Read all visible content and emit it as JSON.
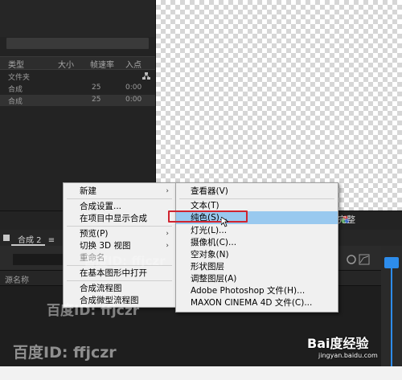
{
  "project_panel": {
    "columns": [
      "类型",
      "大小",
      "帧速率",
      "入点"
    ],
    "rows": [
      {
        "type": "文件夹",
        "size": "",
        "fps": "",
        "in": ""
      },
      {
        "type": "合成",
        "size": "",
        "fps": "25",
        "in": "0:00"
      },
      {
        "type": "合成",
        "size": "",
        "fps": "25",
        "in": "0:00"
      }
    ]
  },
  "timeline": {
    "comp_tab": "合成 2",
    "menu_glyph": "≡",
    "source_name_header": "源名称"
  },
  "workspace": {
    "label": "完整"
  },
  "context_menu": {
    "items": [
      {
        "label": "新建",
        "arrow": "›"
      },
      {
        "label": "合成设置..."
      },
      {
        "label": "在项目中显示合成"
      },
      {
        "label": "预览(P)",
        "arrow": "›"
      },
      {
        "label": "切换 3D 视图",
        "arrow": "›"
      },
      {
        "label": "重命名"
      },
      {
        "label": "在基本图形中打开"
      },
      {
        "label": "合成流程图"
      },
      {
        "label": "合成微型流程图"
      }
    ]
  },
  "submenu_new": {
    "items": [
      {
        "label": "查看器(V)"
      },
      {
        "label": "文本(T)"
      },
      {
        "label": "纯色(S)..."
      },
      {
        "label": "灯光(L)..."
      },
      {
        "label": "摄像机(C)..."
      },
      {
        "label": "空对象(N)"
      },
      {
        "label": "形状图层"
      },
      {
        "label": "调整图层(A)"
      },
      {
        "label": "Adobe Photoshop 文件(H)..."
      },
      {
        "label": "MAXON CINEMA 4D 文件(C)..."
      }
    ]
  },
  "watermark": {
    "text": "百度ID: ffjczr",
    "site": "jingyan.baidu.com",
    "brand": "Bai度经验"
  },
  "colors": {
    "highlight": "#99c9ef",
    "red_box": "#d0242f",
    "playhead": "#2d8ceb"
  }
}
